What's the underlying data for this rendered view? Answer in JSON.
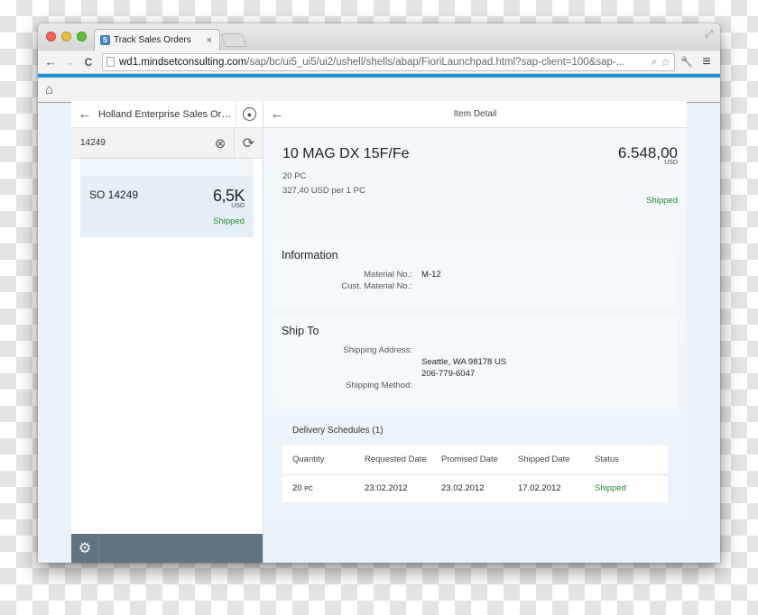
{
  "browser": {
    "tab_title": "Track Sales Orders",
    "tab_favicon": "S",
    "tab_close": "×",
    "url_host": "wd1.mindsetconsulting.com",
    "url_path": "/sap/bc/ui5_ui5/ui2/ushell/shells/abap/FioriLaunchpad.html?sap-client=100&sap-...",
    "icons": {
      "back": "←",
      "forward": "→",
      "reload": "C",
      "zoom": "⌕",
      "star": "☆",
      "wrench": "🔧",
      "menu": "≡",
      "fullscreen": "⤢"
    }
  },
  "shell": {
    "home_icon": "⌂"
  },
  "master": {
    "title": "Holland Enterprise Sales Orders",
    "back_icon": "←",
    "user_icon": "●",
    "search": {
      "value": "14249",
      "clear_icon": "⊗",
      "refresh_icon": "⟳"
    },
    "items": [
      {
        "title": "SO 14249",
        "amount": "6,5K",
        "currency": "USD",
        "status": "Shipped"
      }
    ],
    "footer": {
      "settings_icon": "⚙"
    }
  },
  "detail": {
    "header_title": "Item Detail",
    "back_icon": "←",
    "object": {
      "title": "10 MAG DX 15F/Fe",
      "quantity": "20 PC",
      "unit_price": "327,40 USD per 1 PC",
      "amount": "6.548,00",
      "currency": "USD",
      "status": "Shipped"
    },
    "information": {
      "title": "Information",
      "rows": [
        {
          "label": "Material No.:",
          "value": "M-12"
        },
        {
          "label": "Cust. Material No.:",
          "value": ""
        }
      ]
    },
    "ship_to": {
      "title": "Ship To",
      "address_label": "Shipping Address:",
      "address_line1": "Seattle, WA 98178 US",
      "address_line2": "206-779-6047",
      "method_label": "Shipping Method:",
      "method_value": ""
    },
    "schedules": {
      "title": "Delivery Schedules (1)",
      "columns": [
        "Quantity",
        "Requested Date",
        "Promised Date",
        "Shipped Date",
        "Status"
      ],
      "rows": [
        {
          "quantity": "20",
          "unit": "PC",
          "requested": "23.02.2012",
          "promised": "23.02.2012",
          "shipped": "17.02.2012",
          "status": "Shipped"
        }
      ]
    }
  },
  "colors": {
    "accent_blue": "#1e90d4",
    "status_green": "#2b8a2e",
    "footer_slate": "#617380"
  }
}
